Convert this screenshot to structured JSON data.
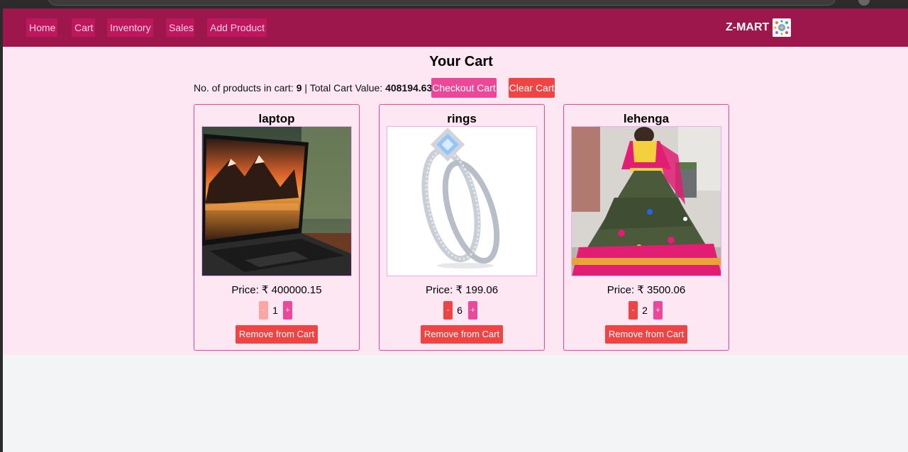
{
  "nav": {
    "links": [
      "Home",
      "Cart",
      "Inventory",
      "Sales",
      "Add Product"
    ],
    "brand": "Z-MART",
    "logo_icon": "zmart-logo-icon"
  },
  "cart": {
    "title": "Your Cart",
    "count_label": "No. of products in cart:",
    "count_value": "9",
    "separator": "|",
    "total_label": "Total Cart Value:",
    "total_value": "408194.63",
    "checkout_label": "Checkout Cart",
    "clear_label": "Clear Cart"
  },
  "items": [
    {
      "name": "laptop",
      "price_label": "Price: ₹ 400000.15",
      "quantity": "1",
      "minus": "-",
      "plus": "+",
      "remove_label": "Remove from Cart",
      "image_icon": "laptop-image"
    },
    {
      "name": "rings",
      "price_label": "Price: ₹ 199.06",
      "quantity": "6",
      "minus": "-",
      "plus": "+",
      "remove_label": "Remove from Cart",
      "image_icon": "ring-image"
    },
    {
      "name": "lehenga",
      "price_label": "Price: ₹ 3500.06",
      "quantity": "2",
      "minus": "-",
      "plus": "+",
      "remove_label": "Remove from Cart",
      "image_icon": "lehenga-image"
    }
  ],
  "colors": {
    "navbar": "#9d174d",
    "nav_link_bg": "#be185d",
    "page_bg": "#fce7f3",
    "pink_button": "#ec4899",
    "red_button": "#ef4444"
  }
}
